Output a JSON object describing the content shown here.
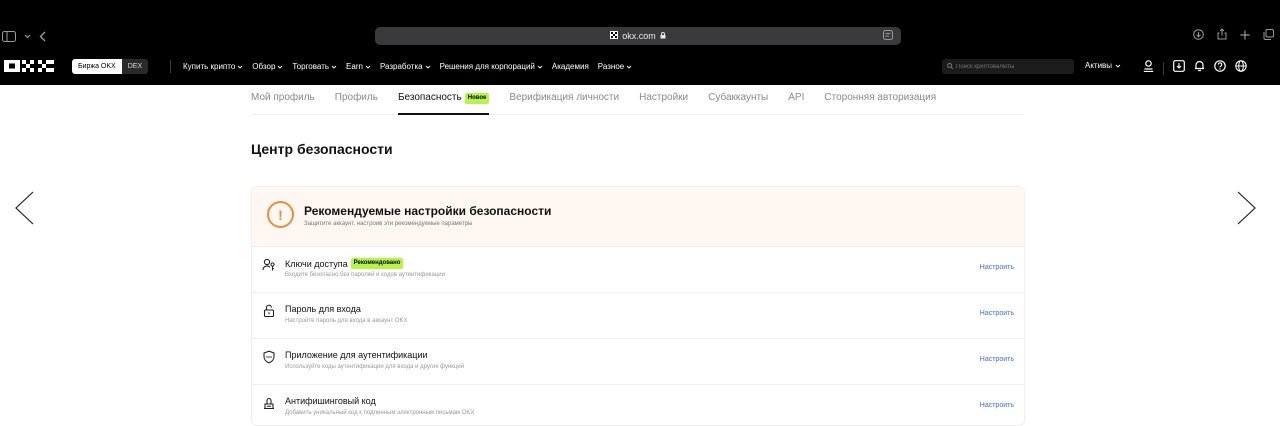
{
  "browser": {
    "url": "okx.com"
  },
  "nav": {
    "segments": [
      "Биржа OKX",
      "DEX"
    ],
    "menu": [
      "Купить крипто",
      "Обзор",
      "Торговать",
      "Earn",
      "Разработка",
      "Решения для корпораций",
      "Академия",
      "Разное"
    ],
    "menu_has_chevron": [
      true,
      true,
      true,
      true,
      true,
      true,
      false,
      true
    ],
    "search_placeholder": "Поиск криптовалюты",
    "assets": "Активы"
  },
  "tabs": [
    {
      "label": "Мой профиль",
      "active": false
    },
    {
      "label": "Профиль",
      "active": false
    },
    {
      "label": "Безопасность",
      "active": true,
      "badge": "Новое"
    },
    {
      "label": "Верификация личности",
      "active": false
    },
    {
      "label": "Настройки",
      "active": false
    },
    {
      "label": "Субаккаунты",
      "active": false
    },
    {
      "label": "API",
      "active": false
    },
    {
      "label": "Сторонняя авторизация",
      "active": false
    }
  ],
  "page_title": "Центр безопасности",
  "security": {
    "title": "Рекомендуемые настройки безопасности",
    "subtitle": "Защитите аккаунт, настроив эти рекомендуемые параметры",
    "items": [
      {
        "icon": "passkey-icon",
        "title": "Ключи доступа",
        "badge": "Рекомендовано",
        "desc": "Входите безопасно без паролей и кодов аутентификации",
        "action": "Настроить"
      },
      {
        "icon": "lock-icon",
        "title": "Пароль для входа",
        "badge": "",
        "desc": "Настройте пароль для входа в аккаунт OKX",
        "action": "Настроить"
      },
      {
        "icon": "shield-icon",
        "title": "Приложение для аутентификации",
        "badge": "",
        "desc": "Используйте коды аутентификации для входа и других функций",
        "action": "Настроить"
      },
      {
        "icon": "anti-phishing-icon",
        "title": "Антифишинговый код",
        "badge": "",
        "desc": "Добавить уникальный код к подлинным электронным письмам OKX",
        "action": "Настроить"
      }
    ]
  }
}
